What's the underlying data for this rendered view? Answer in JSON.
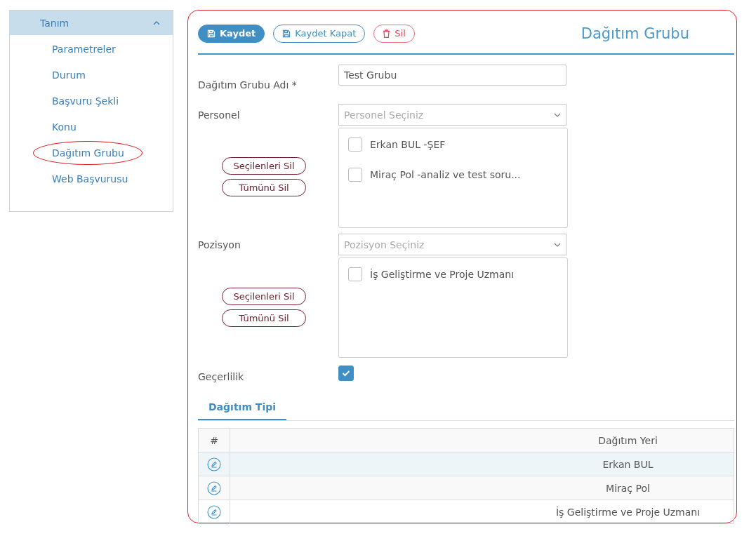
{
  "sidebar": {
    "group": {
      "label": "Tanım",
      "expanded": true
    },
    "items": [
      {
        "label": "Parametreler",
        "selected": false
      },
      {
        "label": "Durum",
        "selected": false
      },
      {
        "label": "Başvuru Şekli",
        "selected": false
      },
      {
        "label": "Konu",
        "selected": false
      },
      {
        "label": "Dağıtım Grubu",
        "selected": true
      },
      {
        "label": "Web Başvurusu",
        "selected": false
      }
    ]
  },
  "toolbar": {
    "buttons": [
      {
        "label": "Kaydet",
        "kind": "primary"
      },
      {
        "label": "Kaydet Kapat",
        "kind": "outline"
      },
      {
        "label": "Sil",
        "kind": "danger"
      }
    ],
    "title": "Dağıtım Grubu"
  },
  "form": {
    "name_field": {
      "label": "Dağıtım Grubu Adı *",
      "value": "Test Grubu"
    },
    "pickers": [
      {
        "label": "Personel",
        "placeholder": "Personel Seçiniz",
        "items": [
          {
            "label": "Erkan BUL -ŞEF",
            "checked": false
          },
          {
            "label": "Miraç Pol -analiz ve test soru...",
            "checked": false
          }
        ],
        "buttons": [
          "Seçilenleri Sil",
          "Tümünü Sil"
        ]
      },
      {
        "label": "Pozisyon",
        "placeholder": "Pozisyon Seçiniz",
        "items": [
          {
            "label": "İş Geliştirme ve Proje Uzmanı",
            "checked": false
          }
        ],
        "buttons": [
          "Seçilenleri Sil",
          "Tümünü Sil"
        ]
      }
    ],
    "validity": {
      "label": "Geçerlilik",
      "checked": true
    }
  },
  "tabs": [
    {
      "label": "Dağıtım Tipi",
      "selected": true
    }
  ],
  "table": {
    "columns": [
      "#",
      "Dağıtım Yeri"
    ],
    "rows": [
      {
        "cells": [
          "Erkan BUL"
        ],
        "highlighted": true
      },
      {
        "cells": [
          "Miraç Pol"
        ],
        "highlighted": false
      },
      {
        "cells": [
          "İş Geliştirme ve Proje Uzmanı"
        ],
        "highlighted": false
      }
    ]
  }
}
